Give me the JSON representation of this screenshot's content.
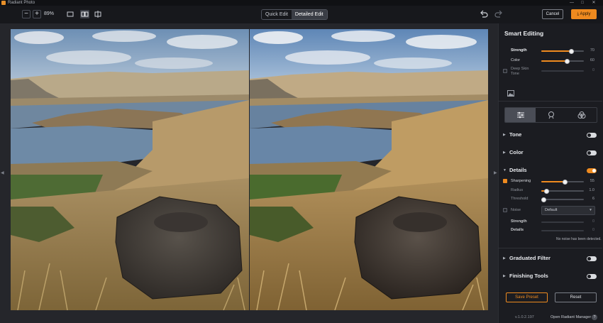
{
  "window": {
    "title": "Radiant Photo",
    "controls": {
      "minimize": "—",
      "maximize": "□",
      "close": "✕"
    }
  },
  "toolbar": {
    "zoom_out": "−",
    "zoom_in": "+",
    "zoom_level": "89%",
    "view_modes": [
      "single-view-icon",
      "side-by-side-icon",
      "split-view-icon"
    ],
    "edit_modes": [
      {
        "label": "Quick Edit",
        "active": false
      },
      {
        "label": "Detailed Edit",
        "active": true
      }
    ],
    "cancel_label": "Cancel",
    "apply_label": "Apply",
    "accent": "#ee8a1f"
  },
  "canvas": {
    "left_arrow": "◀",
    "right_arrow": "▶"
  },
  "panel": {
    "title": "Smart Editing",
    "smart": {
      "strength": {
        "label": "Strength",
        "value": "70",
        "fraction": 0.7
      },
      "color": {
        "label": "Color",
        "value": "60",
        "fraction": 0.6
      },
      "deep_skin": {
        "label_line1": "Deep Skin",
        "label_line2": "Tone",
        "value": "0",
        "fraction": 0
      }
    },
    "image_icon": "image-icon",
    "tabs": [
      "sliders-icon",
      "portrait-icon",
      "color-circles-icon"
    ],
    "sections": {
      "tone": {
        "label": "Tone",
        "enabled": false
      },
      "color": {
        "label": "Color",
        "enabled": false
      },
      "details": {
        "label": "Details",
        "enabled": true
      },
      "graduated": {
        "label": "Graduated Filter",
        "enabled": false
      },
      "finishing": {
        "label": "Finishing Tools",
        "enabled": false
      }
    },
    "details": {
      "sharpening": {
        "label": "Sharpening",
        "value": "55",
        "fraction": 0.55
      },
      "radius": {
        "label": "Radius",
        "value": "1.0",
        "fraction": 0.12
      },
      "threshold": {
        "label": "Threshold",
        "value": "6",
        "fraction": 0.06
      },
      "noise": {
        "label": "Noise",
        "selected": "Default"
      },
      "noise_strength": {
        "label": "Strength",
        "value": "0"
      },
      "noise_details": {
        "label": "Details",
        "value": "0"
      },
      "note": "No noise has been detected."
    },
    "save_preset": "Save Preset",
    "reset": "Reset",
    "version": "v.1.0.2.197",
    "manager": "Open Radiant Manager",
    "help": "?"
  }
}
